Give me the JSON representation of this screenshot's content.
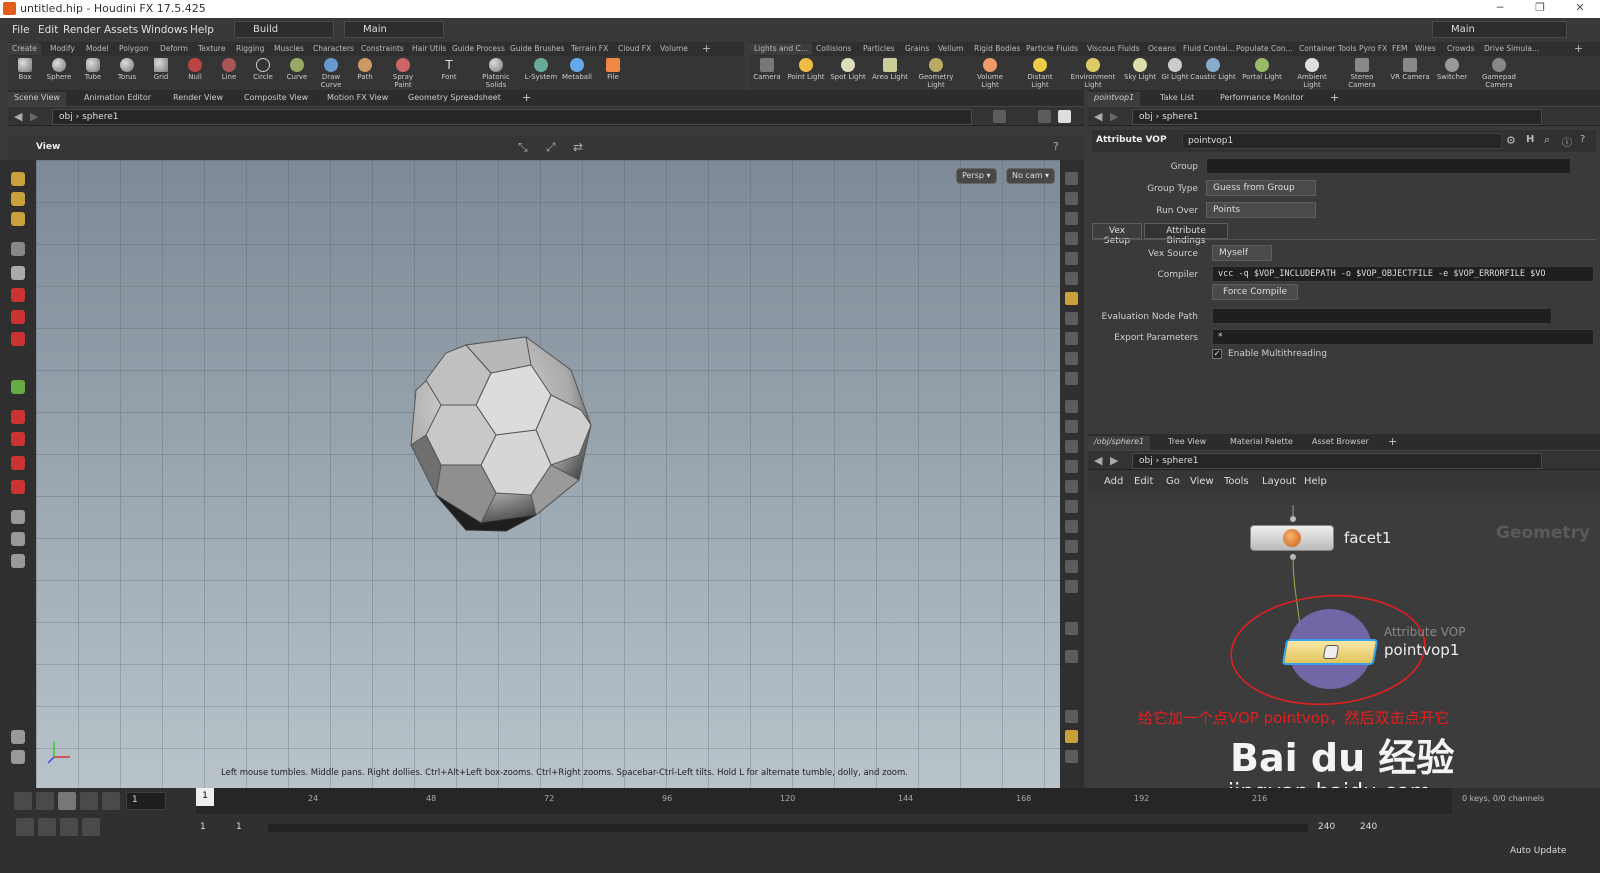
{
  "window": {
    "title": "untitled.hip - Houdini FX 17.5.425"
  },
  "menubar": {
    "items": [
      "File",
      "Edit",
      "Render",
      "Assets",
      "Windows",
      "Help"
    ],
    "desktop": "Build",
    "main": "Main",
    "right_desktop": "Main"
  },
  "shelf_left": {
    "tabs": [
      "Create",
      "Modify",
      "Model",
      "Polygon",
      "Deform",
      "Texture",
      "Rigging",
      "Muscles",
      "Characters",
      "Constraints",
      "Hair Utils",
      "Guide Process",
      "Guide Brushes",
      "Terrain FX",
      "Cloud FX",
      "Volume"
    ],
    "tools": [
      "Box",
      "Sphere",
      "Tube",
      "Torus",
      "Grid",
      "Null",
      "Line",
      "Circle",
      "Curve",
      "Draw Curve",
      "Path",
      "Spray Paint",
      "Font",
      "Platonic Solids",
      "L-System",
      "Metaball",
      "File"
    ]
  },
  "shelf_right": {
    "tabs": [
      "Lights and C...",
      "Collisions",
      "Particles",
      "Grains",
      "Vellum",
      "Rigid Bodies",
      "Particle Fluids",
      "Viscous Fluids",
      "Oceans",
      "Fluid Contai...",
      "Populate Con...",
      "Container Tools",
      "Pyro FX",
      "FEM",
      "Wires",
      "Crowds",
      "Drive Simula..."
    ],
    "tools": [
      "Camera",
      "Point Light",
      "Spot Light",
      "Area Light",
      "Geometry Light",
      "Volume Light",
      "Distant Light",
      "Environment Light",
      "Sky Light",
      "GI Light",
      "Caustic Light",
      "Portal Light",
      "Ambient Light",
      "Stereo Camera",
      "VR Camera",
      "Switcher",
      "Gamepad Camera"
    ]
  },
  "left_pane": {
    "tabs": [
      "Scene View",
      "Animation Editor",
      "Render View",
      "Composite View",
      "Motion FX View",
      "Geometry Spreadsheet"
    ],
    "path_root": "obj",
    "path_node": "sphere1",
    "view_label": "View",
    "persp": "Persp ▾",
    "cam": "No cam ▾",
    "hint": "Left mouse tumbles. Middle pans. Right dollies. Ctrl+Alt+Left box-zooms. Ctrl+Right zooms. Spacebar-Ctrl-Left tilts. Hold L for alternate tumble, dolly, and zoom."
  },
  "params": {
    "tabs": [
      "pointvop1",
      "Take List",
      "Performance Monitor"
    ],
    "path_root": "obj",
    "path_node": "sphere1",
    "node_type": "Attribute VOP",
    "node_name": "pointvop1",
    "group_label": "Group",
    "group_type_label": "Group Type",
    "group_type": "Guess from Group",
    "run_over_label": "Run Over",
    "run_over": "Points",
    "subtabs": [
      "Vex Setup",
      "Attribute Bindings"
    ],
    "vex_source_label": "Vex Source",
    "vex_source": "Myself",
    "compiler_label": "Compiler",
    "compiler": "vcc -q $VOP_INCLUDEPATH -o $VOP_OBJECTFILE -e $VOP_ERRORFILE $VO",
    "force_compile": "Force Compile",
    "eval_label": "Evaluation Node Path",
    "export_label": "Export Parameters",
    "export_value": "*",
    "multithread": "Enable Multithreading"
  },
  "network": {
    "tabs": [
      "/obj/sphere1",
      "Tree View",
      "Material Palette",
      "Asset Browser"
    ],
    "path_root": "obj",
    "path_node": "sphere1",
    "menu": [
      "Add",
      "Edit",
      "Go",
      "View",
      "Tools",
      "Layout",
      "Help"
    ],
    "context": "Geometry",
    "node1": "facet1",
    "node2_type": "Attribute VOP",
    "node2": "pointvop1"
  },
  "annotation": "给它加一个点VOP pointvop，然后双击点开它",
  "watermark": {
    "main": "Bai du 经验",
    "url": "jingyan.baidu.com"
  },
  "timeline": {
    "frame": "1",
    "ticks": [
      "24",
      "48",
      "72",
      "96",
      "120",
      "144",
      "168",
      "192",
      "216"
    ],
    "start": "1",
    "start2": "1",
    "end": "240",
    "end2": "240",
    "keys": "0 keys, 0/0 channels",
    "auto_update": "Auto Update"
  }
}
